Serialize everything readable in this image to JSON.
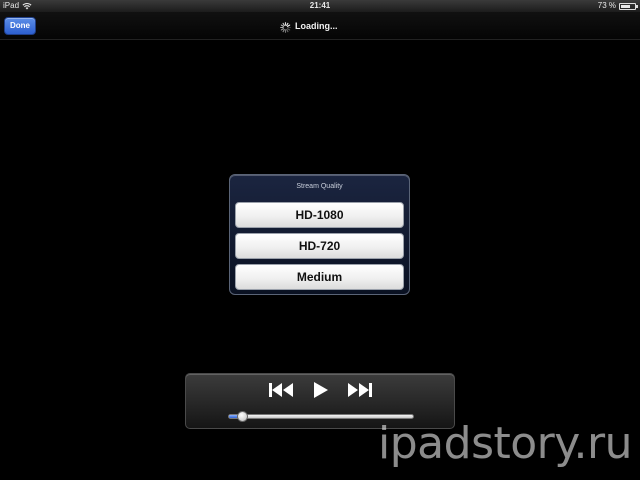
{
  "status_bar": {
    "device": "iPad",
    "time": "21:41",
    "battery_text": "73 %",
    "battery_level": 0.73,
    "wifi_icon": "wifi-icon",
    "battery_icon": "battery-icon"
  },
  "nav_bar": {
    "done_label": "Done",
    "loading_text": "Loading...",
    "spinner_icon": "spinner-icon",
    "done_color": "#3a6fd8"
  },
  "quality_sheet": {
    "title": "Stream Quality",
    "options": [
      {
        "label": "HD-1080"
      },
      {
        "label": "HD-720"
      },
      {
        "label": "Medium"
      }
    ]
  },
  "transport": {
    "prev_icon": "skip-back-icon",
    "play_icon": "play-icon",
    "next_icon": "skip-forward-icon",
    "progress": 0.07
  },
  "watermark": {
    "text": "ipadstory.ru"
  }
}
